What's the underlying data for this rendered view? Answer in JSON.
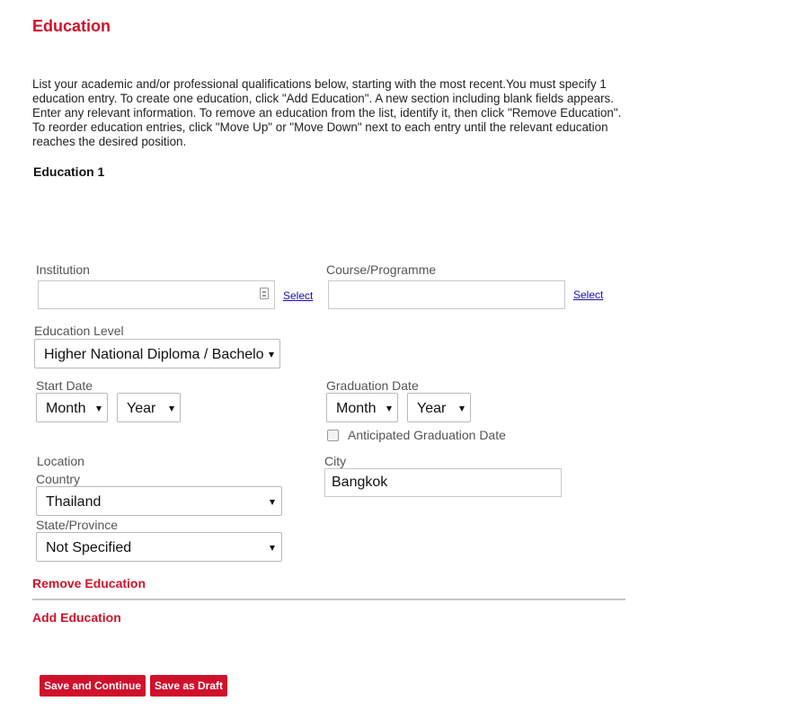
{
  "page": {
    "title": "Education",
    "intro": "List your academic and/or professional qualifications below, starting with the most recent.You must specify 1 education entry. To create one education, click \"Add Education\". A new section including blank fields appears. Enter any relevant information. To remove an education from the list, identify it, then click \"Remove Education\". To reorder education entries, click \"Move Up\" or \"Move Down\" next to each entry until the relevant education reaches the desired position."
  },
  "education": {
    "section_title": "Education 1",
    "institution": {
      "label": "Institution",
      "value": "",
      "select_link": "Select"
    },
    "course": {
      "label": "Course/Programme",
      "value": "",
      "select_link": "Select"
    },
    "education_level": {
      "label": "Education Level",
      "value": "Higher National Diploma / Bachelo"
    },
    "start_date": {
      "label": "Start Date",
      "month": "Month",
      "year": "Year"
    },
    "graduation_date": {
      "label": "Graduation Date",
      "month": "Month",
      "year": "Year",
      "anticipated_label": "Anticipated Graduation Date",
      "anticipated_checked": false
    },
    "location": {
      "label": "Location",
      "country_label": "Country",
      "country": "Thailand",
      "state_label": "State/Province",
      "state": "Not Specified"
    },
    "city": {
      "label": "City",
      "value": "Bangkok"
    },
    "remove_label": "Remove Education"
  },
  "actions": {
    "add_label": "Add Education",
    "save_continue": "Save and Continue",
    "save_draft": "Save as Draft"
  },
  "colors": {
    "accent": "#d0112b",
    "link": "#1a0dab"
  }
}
